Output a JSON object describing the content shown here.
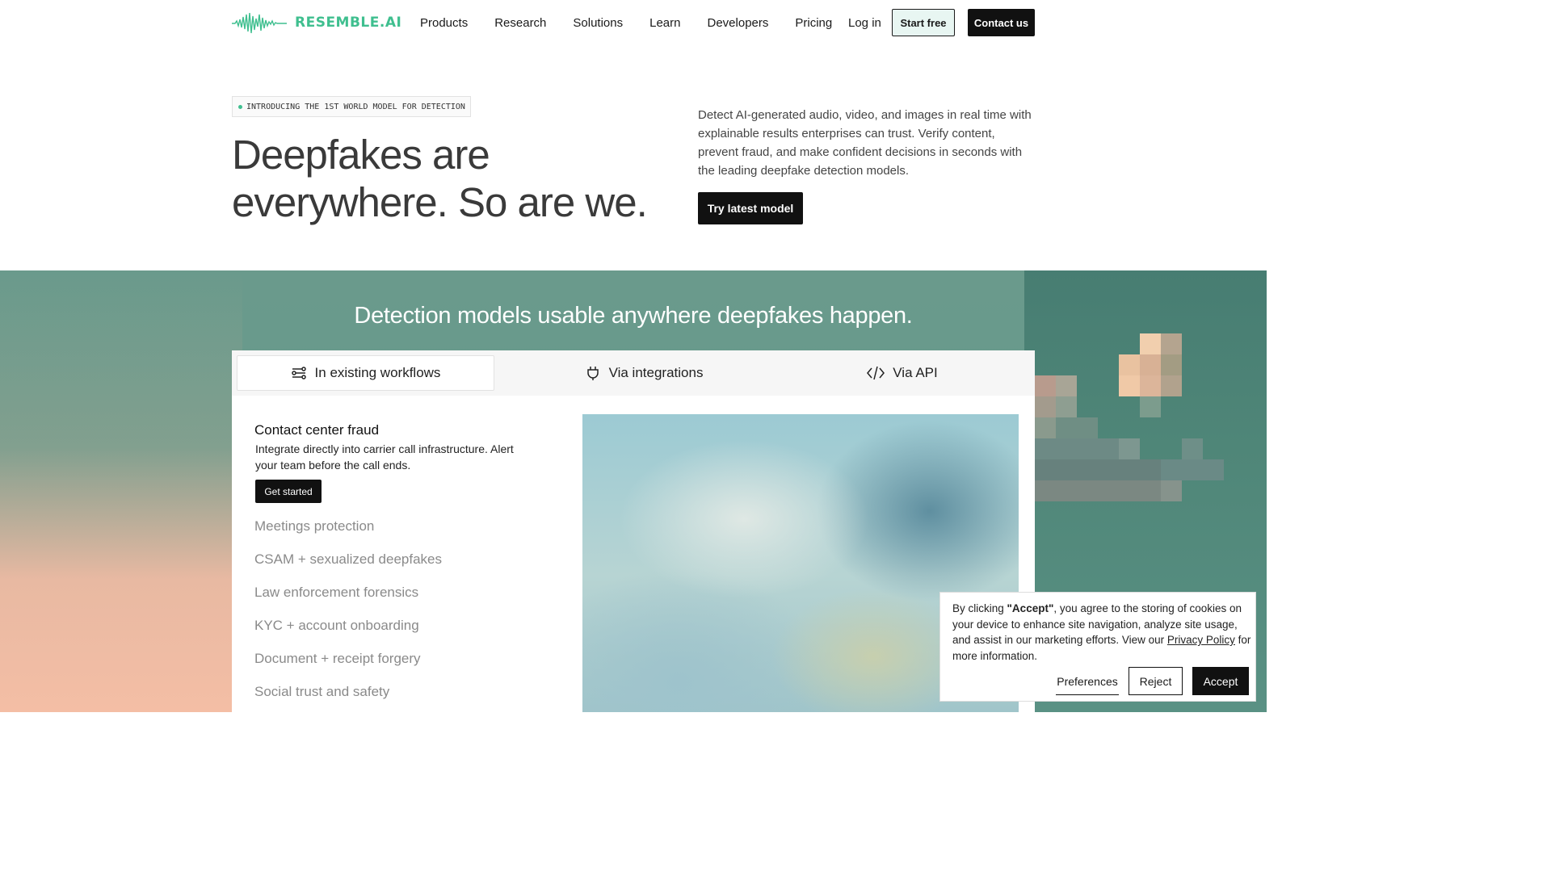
{
  "brand": {
    "name": "RESEMBLE.AI",
    "accent": "#3fbf8f"
  },
  "nav": {
    "links": [
      "Products",
      "Research",
      "Solutions",
      "Learn",
      "Developers",
      "Pricing"
    ],
    "login": "Log in",
    "start_free": "Start free",
    "contact": "Contact us"
  },
  "hero": {
    "badge": "INTRODUCING THE 1ST WORLD MODEL FOR DETECTION",
    "title": "Deepfakes are everywhere. So are we.",
    "description": "Detect AI-generated audio, video, and images in real time with explainable results enterprises can trust. Verify content, prevent fraud, and make confident decisions in seconds with the leading deepfake detection models.",
    "cta": "Try latest model"
  },
  "feature": {
    "title": "Detection models usable anywhere deepfakes happen.",
    "tabs": [
      {
        "label": "In existing workflows",
        "icon": "workflow-icon",
        "active": true
      },
      {
        "label": "Via integrations",
        "icon": "plug-icon",
        "active": false
      },
      {
        "label": "Via API",
        "icon": "code-icon",
        "active": false
      }
    ],
    "active_use_case": {
      "title": "Contact center fraud",
      "description": "Integrate directly into carrier call infrastructure. Alert your team before the call ends.",
      "cta": "Get started"
    },
    "use_cases": [
      "Meetings protection",
      "CSAM + sexualized deepfakes",
      "Law enforcement forensics",
      "KYC + account onboarding",
      "Document + receipt forgery",
      "Social trust and safety"
    ]
  },
  "cookie": {
    "text_before": "By clicking ",
    "text_bold": "\"Accept\"",
    "text_after": ", you agree to the storing of cookies on your device to enhance site navigation, analyze site usage, and assist in our marketing efforts. View our ",
    "link": "Privacy Policy",
    "text_end": " for more information.",
    "preferences": "Preferences",
    "reject": "Reject",
    "accept": "Accept"
  }
}
